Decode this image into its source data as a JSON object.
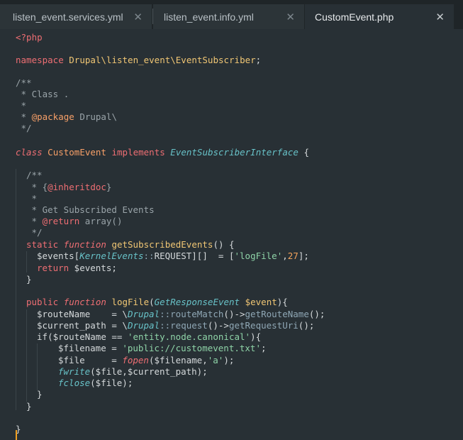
{
  "tabs": [
    {
      "label": "listen_event.services.yml",
      "close": "✕",
      "active": false
    },
    {
      "label": "listen_event.info.yml",
      "close": "✕",
      "active": false
    },
    {
      "label": "CustomEvent.php",
      "close": "✕",
      "active": true
    }
  ],
  "code": {
    "l1": "<?php",
    "l3_ns_kw": "namespace",
    "l3_ns_path": "Drupal\\listen_event\\EventSubscriber",
    "l3_semi": ";",
    "l5": "/**",
    "l6": " * Class .",
    "l7": " *",
    "l8_pre": " * ",
    "l8_tag": "@package",
    "l8_post": " Drupal\\",
    "l9": " */",
    "l11_class": "class",
    "l11_name": "CustomEvent",
    "l11_impl": "implements",
    "l11_iface": "EventSubscriberInterface",
    "l11_brace": " {",
    "l13": "/**",
    "l14_pre": " * {",
    "l14_tag": "@inheritdoc",
    "l14_post": "}",
    "l15": " *",
    "l16": " * Get Subscribed Events",
    "l17_pre": " * ",
    "l17_tag": "@return",
    "l17_post": " array()",
    "l18": " */",
    "l19_static": "static",
    "l19_function": "function",
    "l19_name": "getSubscribedEvents",
    "l19_rest": "() {",
    "l20_var": "$events[",
    "l20_cls": "KernelEvents",
    "l20_op": "::",
    "l20_const": "REQUEST",
    "l20_mid": "][]  = [",
    "l20_str": "'logFile'",
    "l20_comma": ",",
    "l20_num": "27",
    "l20_end": "];",
    "l21_ret": "return",
    "l21_var": " $events;",
    "l22": "}",
    "l24_public": "public",
    "l24_function": "function",
    "l24_name": "logFile",
    "l24_open": "(",
    "l24_type": "GetResponseEvent",
    "l24_param": "$event",
    "l24_close": "){",
    "l25_var": "$routeName    = \\",
    "l25_cls": "Drupal",
    "l25_op": "::",
    "l25_m1": "routeMatch",
    "l25_mid": "()->",
    "l25_m2": "getRouteName",
    "l25_end": "();",
    "l26_var": "$current_path = \\",
    "l26_cls": "Drupal",
    "l26_op": "::",
    "l26_m1": "request",
    "l26_mid": "()->",
    "l26_m2": "getRequestUri",
    "l26_end": "();",
    "l27_if": "if",
    "l27_var": "($routeName == ",
    "l27_str": "'entity.node.canonical'",
    "l27_end": "){",
    "l28_var": "$filename = ",
    "l28_str": "'public://customevent.txt'",
    "l28_end": ";",
    "l29_var": "$file     = ",
    "l29_fn": "fopen",
    "l29_mid": "($filename,",
    "l29_str": "'a'",
    "l29_end": ");",
    "l30_fn": "fwrite",
    "l30_rest": "($file,$current_path);",
    "l31_fn": "fclose",
    "l31_rest": "($file);",
    "l32": "}",
    "l33": "}",
    "l35": "}"
  }
}
